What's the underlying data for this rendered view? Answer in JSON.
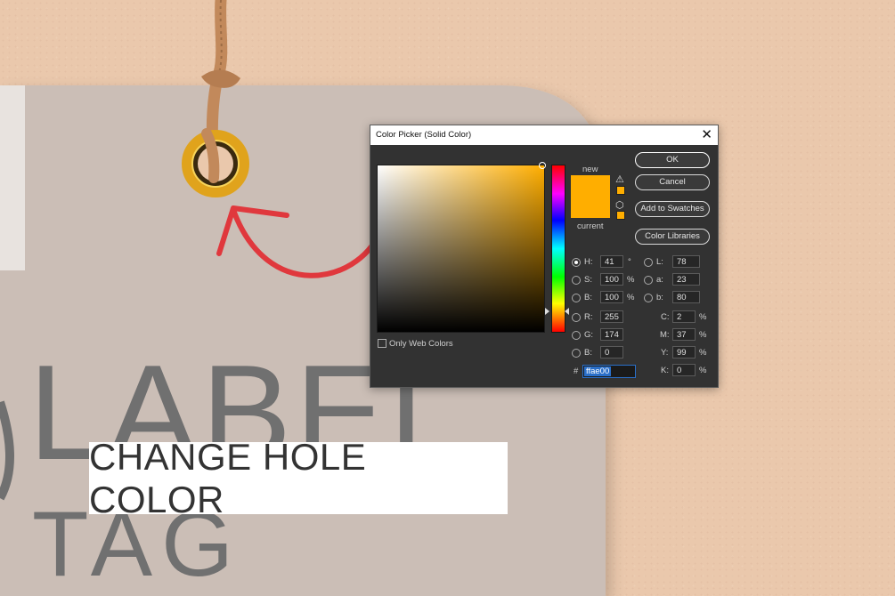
{
  "caption": "CHANGE HOLE COLOR",
  "tag_text": {
    "line1": "LABEL",
    "line2": "TAG"
  },
  "dialog": {
    "title": "Color Picker (Solid Color)",
    "close_glyph": "✕",
    "new_label": "new",
    "current_label": "current",
    "new_color": "#ffae00",
    "current_color": "#ffae00",
    "buttons": {
      "ok": "OK",
      "cancel": "Cancel",
      "add_to_swatches": "Add to Swatches",
      "color_libraries": "Color Libraries"
    },
    "only_web_colors": "Only Web Colors",
    "hsb": {
      "h_label": "H:",
      "h": "41",
      "h_unit": "°",
      "s_label": "S:",
      "s": "100",
      "s_unit": "%",
      "b_label": "B:",
      "b": "100",
      "b_unit": "%"
    },
    "rgb": {
      "r_label": "R:",
      "r": "255",
      "g_label": "G:",
      "g": "174",
      "b_label": "B:",
      "b": "0"
    },
    "lab": {
      "l_label": "L:",
      "l": "78",
      "a_label": "a:",
      "a": "23",
      "b_label": "b:",
      "b": "80"
    },
    "cmyk": {
      "c_label": "C:",
      "c": "2",
      "m_label": "M:",
      "m": "37",
      "y_label": "Y:",
      "y": "99",
      "k_label": "K:",
      "k": "0",
      "unit": "%"
    },
    "hex_label": "#",
    "hex": "ffae00",
    "selected_mode": "H",
    "icons": {
      "gamut_warning": "warning-triangle-icon",
      "web_safe": "cube-icon"
    }
  },
  "colors": {
    "background": "#eac8ac",
    "tag": "#cbbeb6",
    "grommet": "#e0a31c",
    "arrow": "#e0383d",
    "string": "#c2895b"
  }
}
